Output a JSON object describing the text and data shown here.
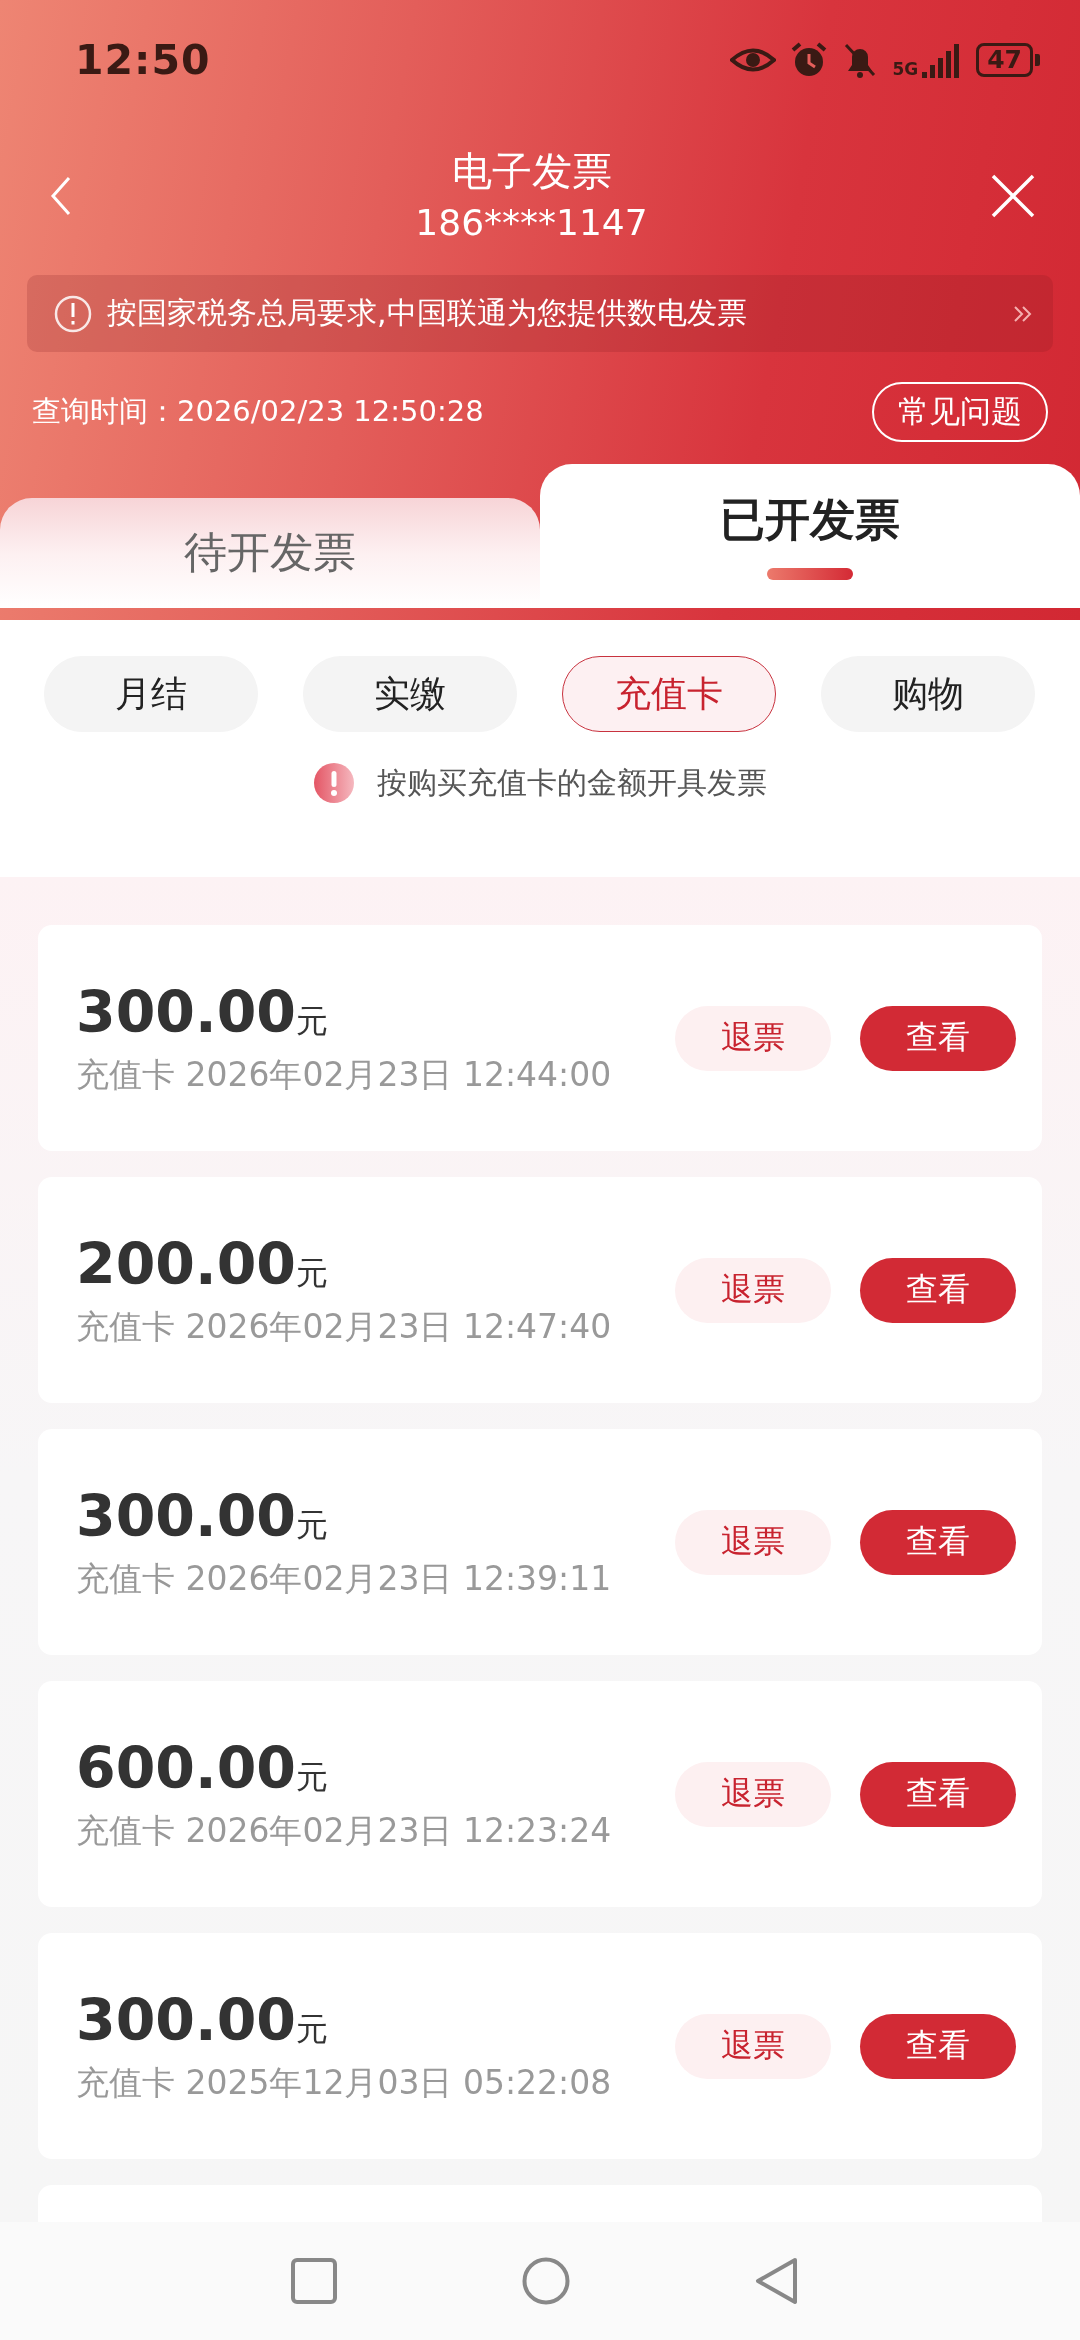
{
  "status_bar": {
    "time": "12:50",
    "network": "5G",
    "battery": "47"
  },
  "header": {
    "title": "电子发票",
    "phone": "186****1147"
  },
  "notice": {
    "text": "按国家税务总局要求,中国联通为您提供数电发票"
  },
  "query_time": "查询时间：2026/02/23 12:50:28",
  "faq_button": "常见问题",
  "tabs": [
    {
      "label": "待开发票",
      "selected": false
    },
    {
      "label": "已开发票",
      "selected": true
    }
  ],
  "filters": [
    {
      "label": "月结",
      "selected": false
    },
    {
      "label": "实缴",
      "selected": false
    },
    {
      "label": "充值卡",
      "selected": true
    },
    {
      "label": "购物",
      "selected": false
    }
  ],
  "hint": "按购买充值卡的金额开具发票",
  "invoices": [
    {
      "amount": "300.00",
      "unit": "元",
      "type": "充值卡",
      "date": "2026年02月23日 12:44:00",
      "refund_button": "退票",
      "view_button": "查看"
    },
    {
      "amount": "200.00",
      "unit": "元",
      "type": "充值卡",
      "date": "2026年02月23日 12:47:40",
      "refund_button": "退票",
      "view_button": "查看"
    },
    {
      "amount": "300.00",
      "unit": "元",
      "type": "充值卡",
      "date": "2026年02月23日 12:39:11",
      "refund_button": "退票",
      "view_button": "查看"
    },
    {
      "amount": "600.00",
      "unit": "元",
      "type": "充值卡",
      "date": "2026年02月23日 12:23:24",
      "refund_button": "退票",
      "view_button": "查看"
    },
    {
      "amount": "300.00",
      "unit": "元",
      "type": "充值卡",
      "date": "2025年12月03日 05:22:08",
      "refund_button": "退票",
      "view_button": "查看"
    }
  ]
}
